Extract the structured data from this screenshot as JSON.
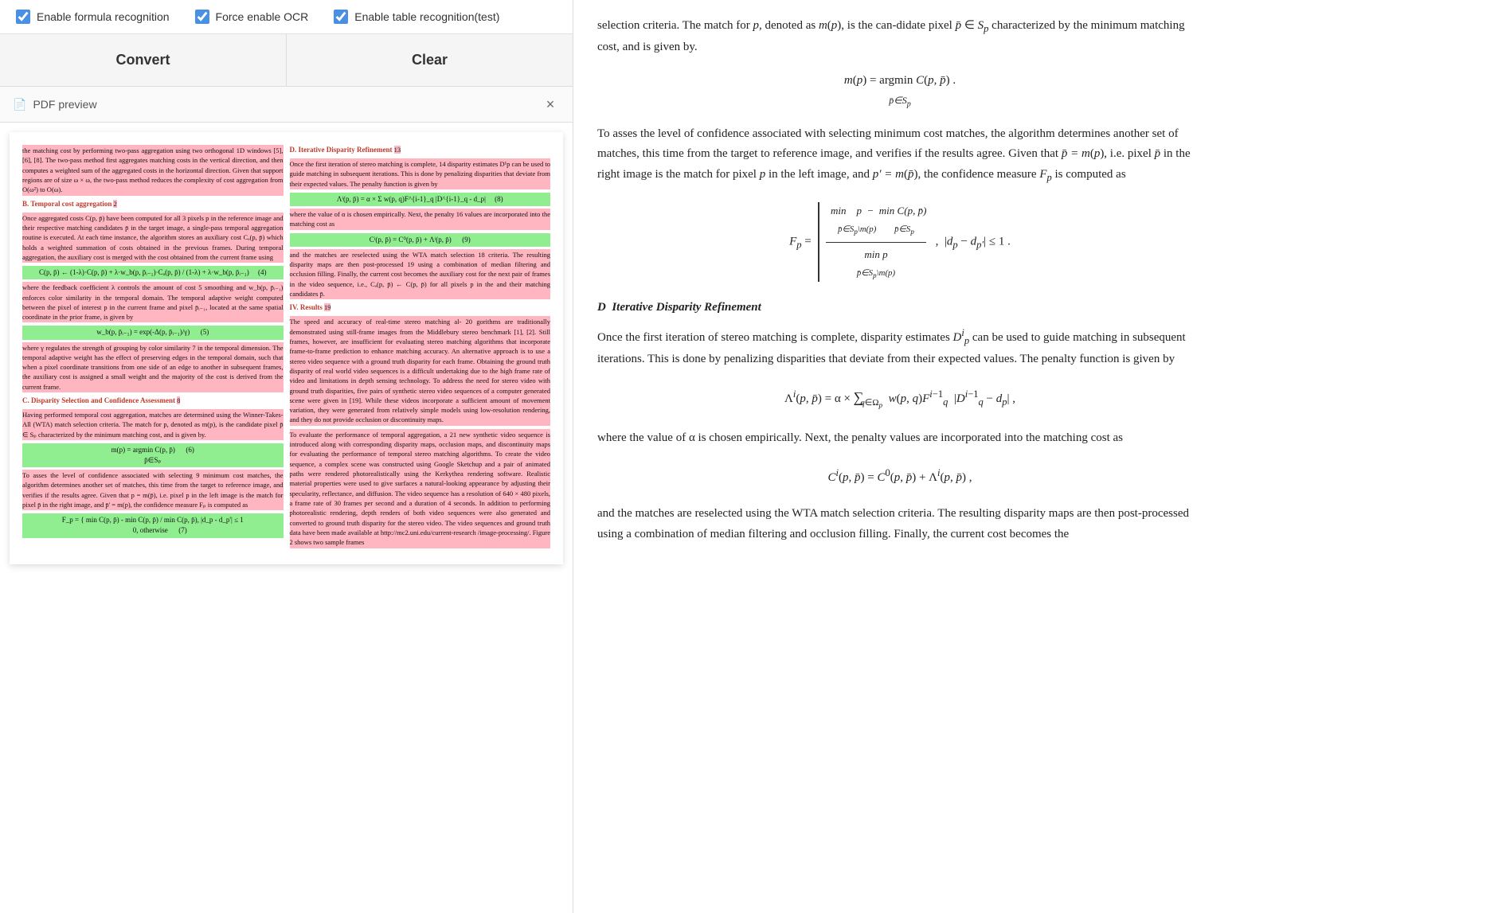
{
  "checkboxes": [
    {
      "id": "formula",
      "label": "Enable formula recognition",
      "checked": true
    },
    {
      "id": "ocr",
      "label": "Force enable OCR",
      "checked": true
    },
    {
      "id": "table",
      "label": "Enable table recognition(test)",
      "checked": true
    }
  ],
  "buttons": {
    "convert": "Convert",
    "clear": "Clear"
  },
  "preview": {
    "title": "PDF preview",
    "close_label": "×"
  },
  "right_panel": {
    "paragraphs": [
      "selection criteria. The match for p, denoted as m(p), is the can-didate pixel p̄ ∈ Sp characterized by the minimum matching cost, and is given by.",
      "To asses the level of confidence associated with selecting minimum cost matches, the algorithm determines another set of matches, this time from the target to reference image, and verifies if the results agree. Given that p̄ = m(p), i.e. pixel p̄ in the right image is the match for pixel p in the left image, and p′ = m(p̄), the confidence measure Fp is computed as",
      "D Iterative Disparity Refinement",
      "Once the first iteration of stereo matching is complete, disparity estimates D¹p can be used to guide matching in subsequent iterations. This is done by penalizing disparities that deviate from their expected values. The penalty function is given by",
      "where the value of α is chosen empirically. Next, the penalty values are incorporated into the matching cost as",
      "and the matches are reselected using the WTA match selection criteria. The resulting disparity maps are then post-processed using a combination of median filtering and occlusion filling. Finally, the current cost becomes the"
    ]
  }
}
